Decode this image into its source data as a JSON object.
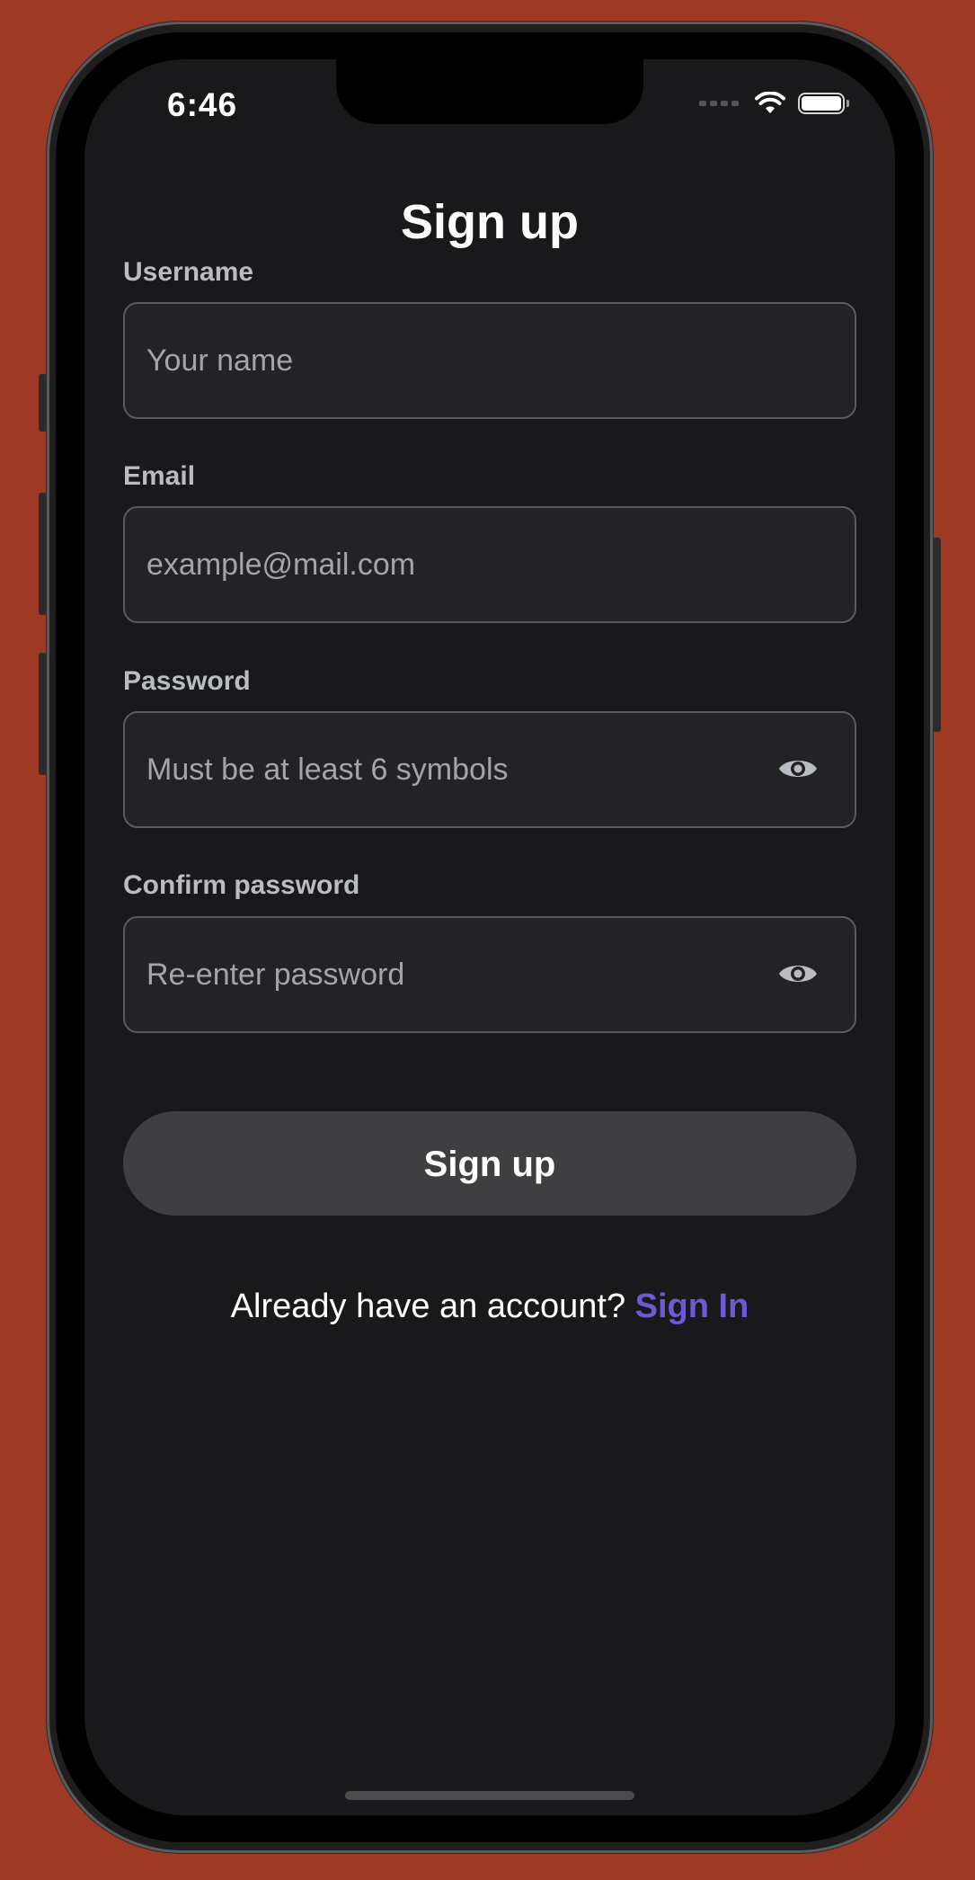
{
  "status_bar": {
    "time": "6:46"
  },
  "page": {
    "title": "Sign up"
  },
  "form": {
    "username": {
      "label": "Username",
      "value": "",
      "placeholder": "Your name"
    },
    "email": {
      "label": "Email",
      "value": "",
      "placeholder": "example@mail.com"
    },
    "password": {
      "label": "Password",
      "value": "",
      "placeholder": "Must be at least 6 symbols"
    },
    "confirm_password": {
      "label": "Confirm password",
      "value": "",
      "placeholder": "Re-enter password"
    },
    "submit_label": "Sign up"
  },
  "footer": {
    "prompt": "Already have an account?",
    "link_label": "Sign In"
  },
  "icons": {
    "password_toggle": "eye-icon",
    "wifi": "wifi-icon",
    "battery": "battery-icon",
    "signal": "cellular-signal-icon"
  },
  "colors": {
    "background": "#9e3a24",
    "screen": "#19191b",
    "field_border": "#5b5b5f",
    "button": "#3f3f42",
    "link": "#6a5ad3"
  }
}
